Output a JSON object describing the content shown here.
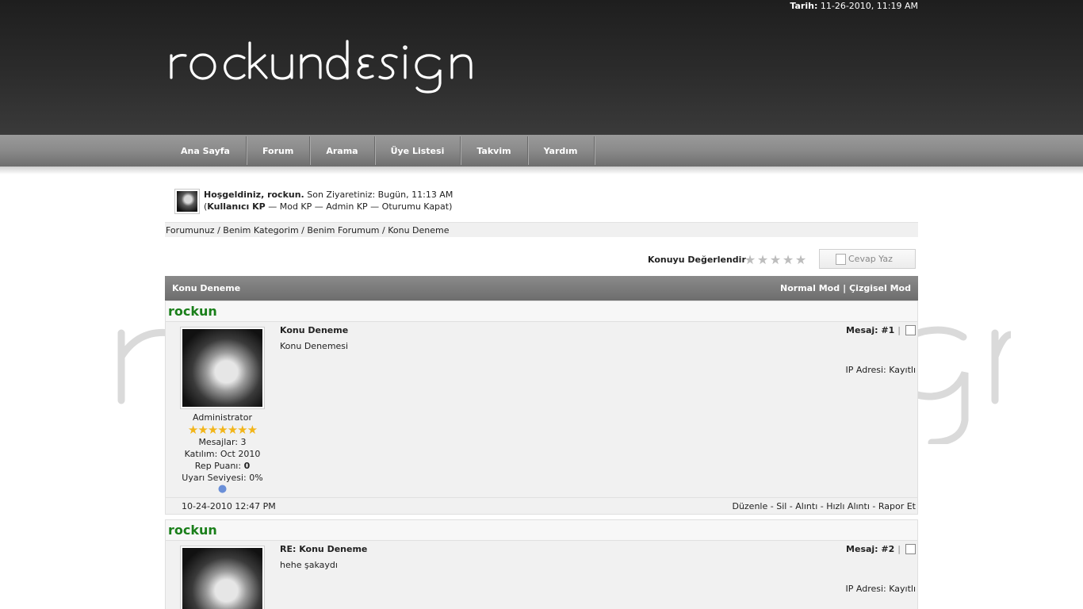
{
  "header": {
    "date_label": "Tarih:",
    "date_value": "11-26-2010, 11:19 AM",
    "logo_text": "rockundesign"
  },
  "nav": {
    "items": [
      "Ana Sayfa",
      "Forum",
      "Arama",
      "Üye Listesi",
      "Takvim",
      "Yardım"
    ]
  },
  "welcome": {
    "greeting": "Hoşgeldiniz, rockun.",
    "last_visit": " Son Ziyaretiniz: Bugün, 11:13 AM",
    "open_paren": "(",
    "user_cp": "Kullanıcı KP",
    "mod_cp": " — Mod KP",
    "admin_cp": " — Admin KP",
    "logout": " — Oturumu Kapat",
    "close_paren": ")"
  },
  "breadcrumb": {
    "items": [
      "Forumunuz",
      "Benim Kategorim",
      "Benim Forumum",
      "Konu Deneme"
    ],
    "separator": " / "
  },
  "rating": {
    "label": "Konuyu Değerlendir",
    "stars": 5,
    "filled": 0
  },
  "reply_button": {
    "label": "Cevap Yaz",
    "icon": "document-icon"
  },
  "thread": {
    "title": "Konu Deneme",
    "mode_normal": "Normal Mod",
    "mode_separator": "|",
    "mode_threaded": "Çizgisel Mod"
  },
  "posts": [
    {
      "username": "Konu Deneme",
      "author": "rockun",
      "rank": "Administrator",
      "rank_stars": 7,
      "messages": "Mesajlar: 3",
      "joined": "Katılım: Oct 2010",
      "rep_label": "Rep Puanı: ",
      "rep_value": "0",
      "warning": "Uyarı Seviyesi: 0%",
      "subject": "Konu Deneme",
      "text": "Konu Denemesi",
      "number": "Mesaj: #1",
      "ip": "IP Adresi: Kayıtlı",
      "date": "10-24-2010 12:47 PM",
      "actions": "Düzenle - Sil - Alıntı - Hızlı Alıntı - Rapor Et"
    },
    {
      "author": "rockun",
      "subject": "RE: Konu Deneme",
      "text": "hehe şakaydı",
      "number": "Mesaj: #2",
      "ip": "IP Adresi: Kayıtlı"
    }
  ],
  "watermark_text": "rockundesign",
  "colors": {
    "header_dark": "#2c2c2c",
    "nav_gray": "#8a8a8a",
    "username_green": "#1a7f1a",
    "star_gold": "#f2b51a"
  }
}
